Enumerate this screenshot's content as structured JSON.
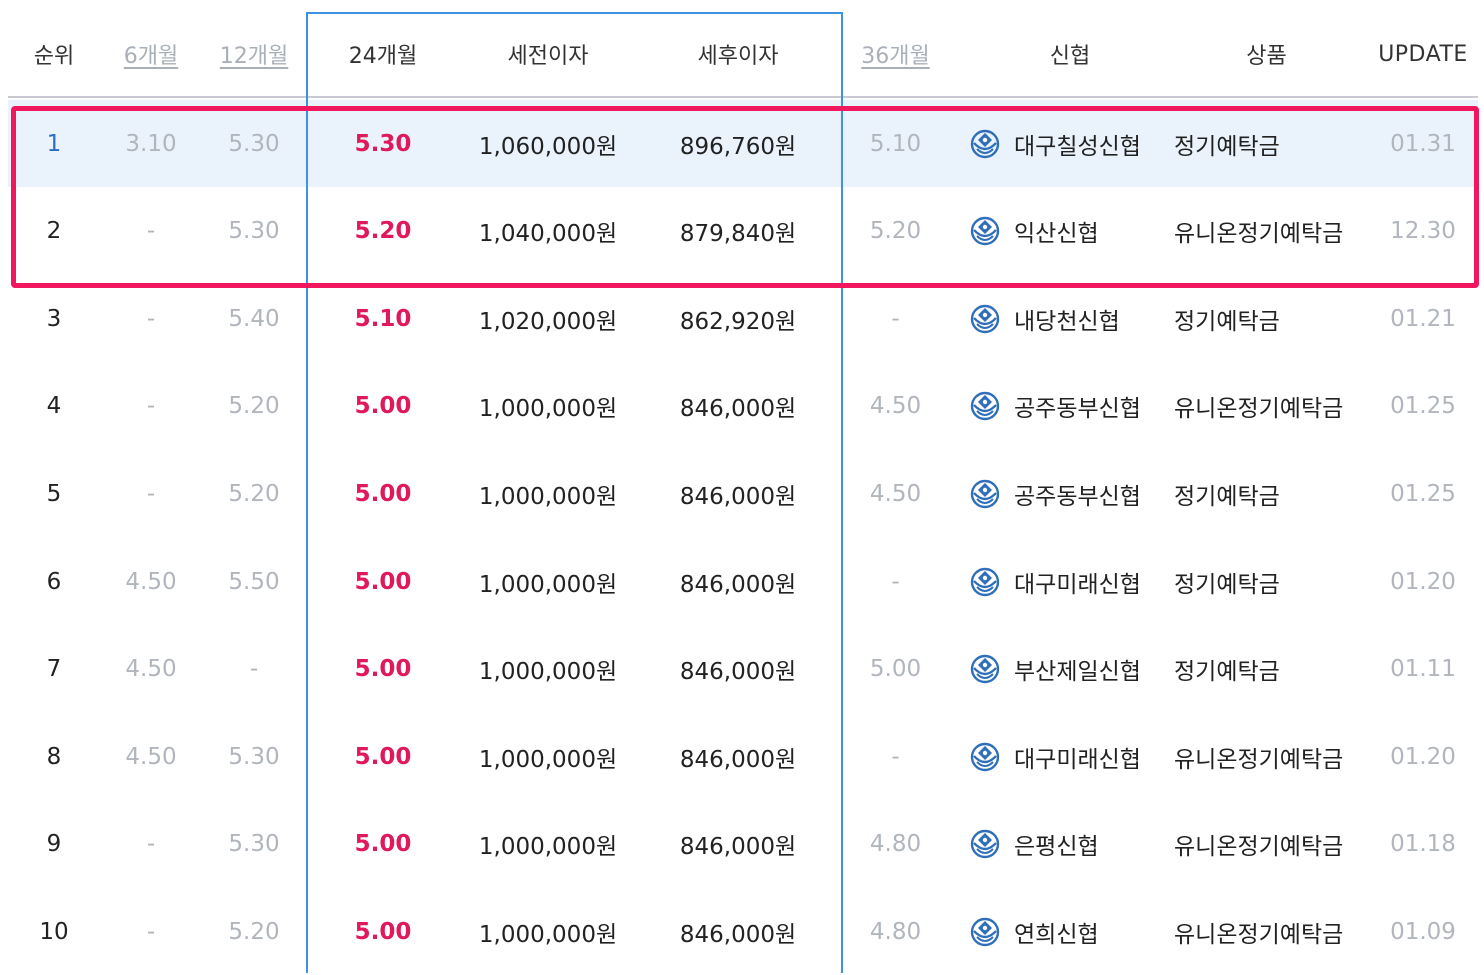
{
  "columns": {
    "rank": "순위",
    "m6": "6개월",
    "m12": "12개월",
    "m24": "24개월",
    "pre_tax": "세전이자",
    "post_tax": "세후이자",
    "m36": "36개월",
    "bank": "신협",
    "product": "상품",
    "update": "UPDATE"
  },
  "rows": [
    {
      "rank": "1",
      "m6": "3.10",
      "m12": "5.30",
      "m24": "5.30",
      "pre_tax": "1,060,000원",
      "post_tax": "896,760원",
      "m36": "5.10",
      "bank": "대구칠성신협",
      "product": "정기예탁금",
      "update": "01.31"
    },
    {
      "rank": "2",
      "m6": "-",
      "m12": "5.30",
      "m24": "5.20",
      "pre_tax": "1,040,000원",
      "post_tax": "879,840원",
      "m36": "5.20",
      "bank": "익산신협",
      "product": "유니온정기예탁금",
      "update": "12.30"
    },
    {
      "rank": "3",
      "m6": "-",
      "m12": "5.40",
      "m24": "5.10",
      "pre_tax": "1,020,000원",
      "post_tax": "862,920원",
      "m36": "-",
      "bank": "내당천신협",
      "product": "정기예탁금",
      "update": "01.21"
    },
    {
      "rank": "4",
      "m6": "-",
      "m12": "5.20",
      "m24": "5.00",
      "pre_tax": "1,000,000원",
      "post_tax": "846,000원",
      "m36": "4.50",
      "bank": "공주동부신협",
      "product": "유니온정기예탁금",
      "update": "01.25"
    },
    {
      "rank": "5",
      "m6": "-",
      "m12": "5.20",
      "m24": "5.00",
      "pre_tax": "1,000,000원",
      "post_tax": "846,000원",
      "m36": "4.50",
      "bank": "공주동부신협",
      "product": "정기예탁금",
      "update": "01.25"
    },
    {
      "rank": "6",
      "m6": "4.50",
      "m12": "5.50",
      "m24": "5.00",
      "pre_tax": "1,000,000원",
      "post_tax": "846,000원",
      "m36": "-",
      "bank": "대구미래신협",
      "product": "정기예탁금",
      "update": "01.20"
    },
    {
      "rank": "7",
      "m6": "4.50",
      "m12": "-",
      "m24": "5.00",
      "pre_tax": "1,000,000원",
      "post_tax": "846,000원",
      "m36": "5.00",
      "bank": "부산제일신협",
      "product": "정기예탁금",
      "update": "01.11"
    },
    {
      "rank": "8",
      "m6": "4.50",
      "m12": "5.30",
      "m24": "5.00",
      "pre_tax": "1,000,000원",
      "post_tax": "846,000원",
      "m36": "-",
      "bank": "대구미래신협",
      "product": "유니온정기예탁금",
      "update": "01.20"
    },
    {
      "rank": "9",
      "m6": "-",
      "m12": "5.30",
      "m24": "5.00",
      "pre_tax": "1,000,000원",
      "post_tax": "846,000원",
      "m36": "4.80",
      "bank": "은평신협",
      "product": "유니온정기예탁금",
      "update": "01.18"
    },
    {
      "rank": "10",
      "m6": "-",
      "m12": "5.20",
      "m24": "5.00",
      "pre_tax": "1,000,000원",
      "post_tax": "846,000원",
      "m36": "4.80",
      "bank": "연희신협",
      "product": "유니온정기예탁금",
      "update": "01.09"
    }
  ],
  "colors": {
    "rate_red": "#e0195a",
    "highlight_border": "#f0175e",
    "selected_column_border": "#3d93e0",
    "row_highlight_bg": "#eaf3fc",
    "logo_blue": "#2f6fba"
  },
  "icons": {
    "bank_logo": "shinhyup-logo-icon"
  }
}
